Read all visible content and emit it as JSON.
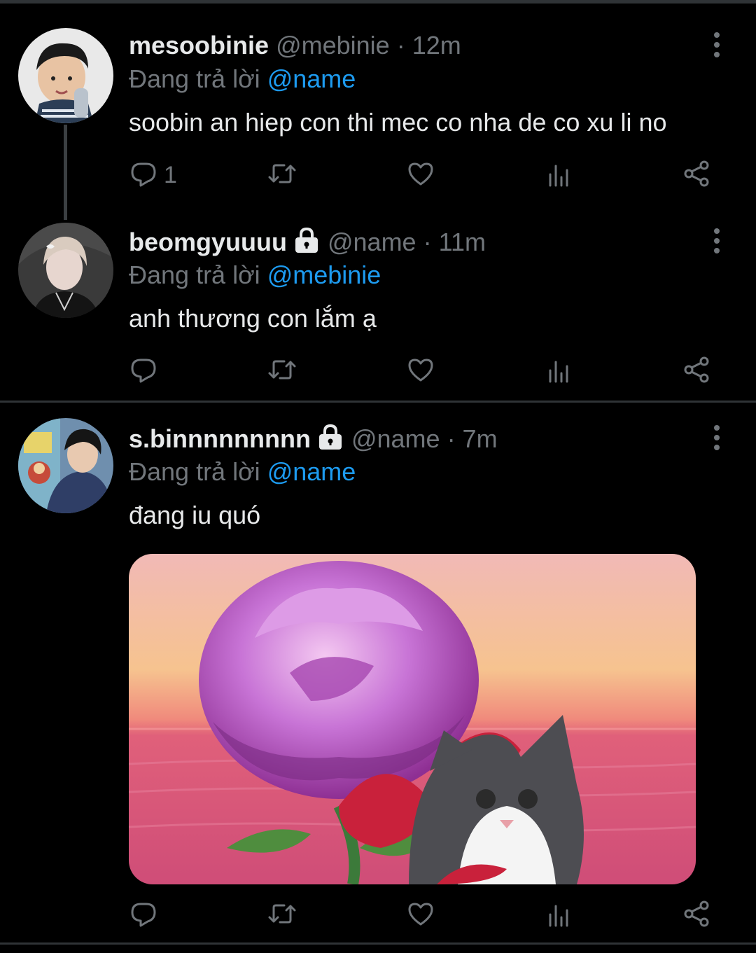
{
  "tweets": [
    {
      "name": "mesoobinie",
      "handle": "@mebinie",
      "time": "· 12m",
      "replying_prefix": "Đang trả lời",
      "replying_to": "@name",
      "text": "soobin an hiep con thi mec co nha de co xu li no",
      "reply_count": "1",
      "locked": false
    },
    {
      "name": "beomgyuuuu",
      "handle": "@name",
      "time": "· 11m",
      "replying_prefix": "Đang trả lời",
      "replying_to": "@mebinie",
      "text": "anh thương con lắm ạ",
      "reply_count": "",
      "locked": true
    },
    {
      "name": "s.binnnnnnnnn",
      "handle": "@name",
      "time": "· 7m",
      "replying_prefix": "Đang trả lời",
      "replying_to": "@name",
      "text": "đang iu quó",
      "reply_count": "",
      "locked": true,
      "media": "rose-and-cat-image"
    }
  ],
  "icons": [
    "reply-icon",
    "retweet-icon",
    "like-icon",
    "analytics-icon",
    "share-icon",
    "more-icon",
    "lock-icon"
  ],
  "colors": {
    "background": "#000000",
    "text": "#e7e9ea",
    "muted": "#71767b",
    "mention": "#1d9bf0",
    "divider": "#2f3336"
  }
}
